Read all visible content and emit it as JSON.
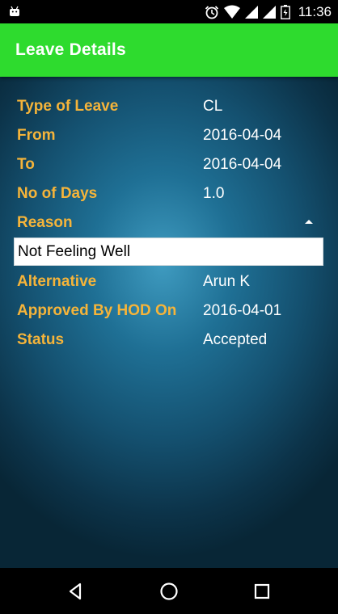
{
  "status_bar": {
    "time": "11:36",
    "icons": [
      "android-icon",
      "alarm-icon",
      "wifi-icon",
      "signal-icon",
      "signal-icon",
      "battery-icon"
    ]
  },
  "app_bar": {
    "title": "Leave Details",
    "color": "#2edb2e"
  },
  "details": {
    "type_of_leave": {
      "label": "Type of Leave",
      "value": "CL"
    },
    "from": {
      "label": "From",
      "value": "2016-04-04"
    },
    "to": {
      "label": "To",
      "value": "2016-04-04"
    },
    "no_of_days": {
      "label": "No of Days",
      "value": "1.0"
    },
    "reason": {
      "label": "Reason",
      "value": "Not Feeling Well"
    },
    "alternative": {
      "label": "Alternative",
      "value": "Arun K"
    },
    "approved_by_hod_on": {
      "label": "Approved By HOD On",
      "value": "2016-04-01"
    },
    "status": {
      "label": "Status",
      "value": "Accepted"
    }
  },
  "colors": {
    "label": "#f5b43a",
    "value": "#ffffff",
    "background": "#1f7095"
  },
  "nav_bar": {
    "buttons": [
      "back-icon",
      "home-icon",
      "recents-icon"
    ]
  }
}
